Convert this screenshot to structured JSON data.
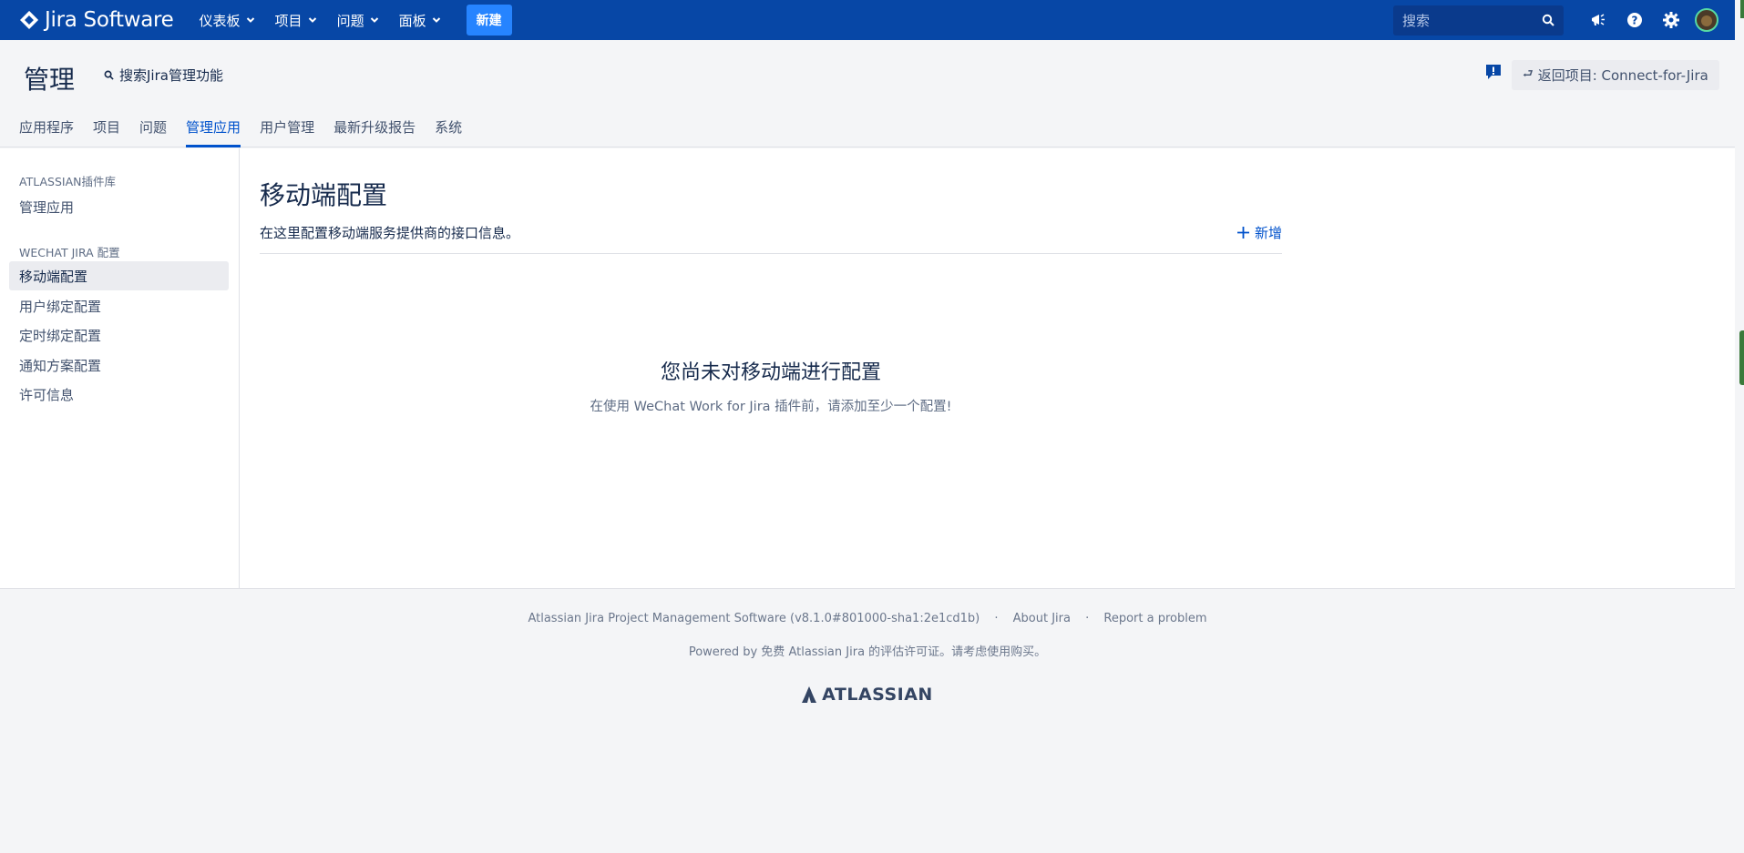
{
  "topnav": {
    "logo_text": "Jira Software",
    "menus": [
      "仪表板",
      "项目",
      "问题",
      "面板"
    ],
    "create_label": "新建",
    "search_placeholder": "搜索",
    "icons": [
      "notifications-icon",
      "help-icon",
      "settings-icon",
      "avatar"
    ],
    "brand_color": "#0747a6",
    "create_color": "#2684ff"
  },
  "admin": {
    "title": "管理",
    "search_label": "搜索Jira管理功能",
    "back_button": "返回项目: Connect-for-Jira",
    "tabs": [
      {
        "label": "应用程序",
        "active": false
      },
      {
        "label": "项目",
        "active": false
      },
      {
        "label": "问题",
        "active": false
      },
      {
        "label": "管理应用",
        "active": true
      },
      {
        "label": "用户管理",
        "active": false
      },
      {
        "label": "最新升级报告",
        "active": false
      },
      {
        "label": "系统",
        "active": false
      }
    ]
  },
  "sidebar": {
    "sections": [
      {
        "heading": "ATLASSIAN插件库",
        "items": [
          {
            "label": "管理应用",
            "active": false
          }
        ]
      },
      {
        "heading": "WECHAT JIRA 配置",
        "items": [
          {
            "label": "移动端配置",
            "active": true
          },
          {
            "label": "用户绑定配置",
            "active": false
          },
          {
            "label": "定时绑定配置",
            "active": false
          },
          {
            "label": "通知方案配置",
            "active": false
          },
          {
            "label": "许可信息",
            "active": false
          }
        ]
      }
    ]
  },
  "content": {
    "title": "移动端配置",
    "description": "在这里配置移动端服务提供商的接口信息。",
    "add_label": "新增",
    "empty_title": "您尚未对移动端进行配置",
    "empty_subtitle": "在使用 WeChat Work for Jira 插件前，请添加至少一个配置!"
  },
  "footer": {
    "software": "Atlassian Jira Project Management Software (v8.1.0#801000-sha1:2e1cd1b)",
    "about": "About Jira",
    "report": "Report a problem",
    "powered_by": "Powered by 免费 Atlassian Jira 的评估许可证。请考虑使用购买。",
    "logo_text": "ATLASSIAN"
  }
}
